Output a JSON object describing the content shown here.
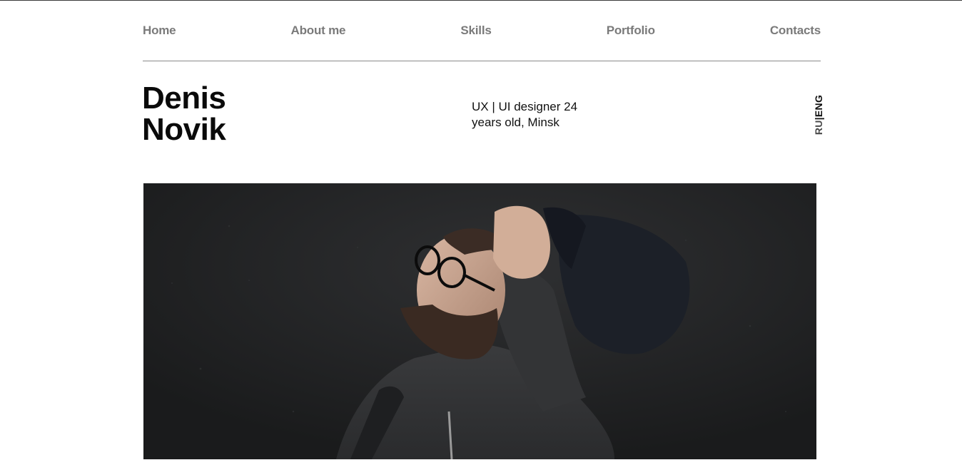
{
  "nav": {
    "items": [
      {
        "label": "Home"
      },
      {
        "label": "About me"
      },
      {
        "label": "Skills"
      },
      {
        "label": "Portfolio"
      },
      {
        "label": "Contacts"
      }
    ]
  },
  "header": {
    "name_line1": "Denis",
    "name_line2": "Novik",
    "bio": "UX | UI designer 24 years old, Minsk"
  },
  "language": {
    "ru": "RU",
    "separator": "|",
    "en": "ENG"
  },
  "colors": {
    "nav_text": "#7a7a7a",
    "title_text": "#0a0a0a",
    "photo_background": "#1f2022"
  }
}
